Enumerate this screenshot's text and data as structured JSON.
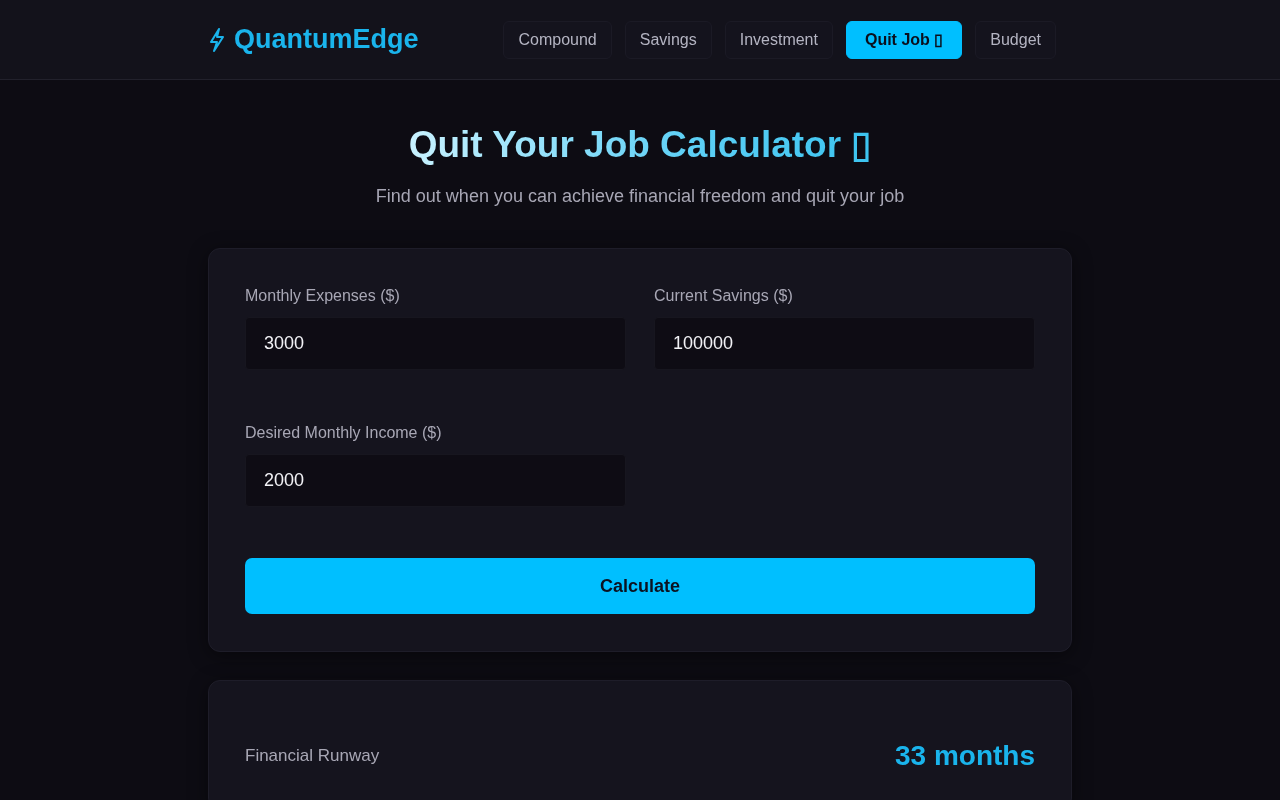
{
  "header": {
    "logo": "QuantumEdge",
    "nav": [
      {
        "label": "Compound",
        "selected": false
      },
      {
        "label": "Savings",
        "selected": false
      },
      {
        "label": "Investment",
        "selected": false
      },
      {
        "label": "Quit Job ▯",
        "selected": true
      },
      {
        "label": "Budget",
        "selected": false
      }
    ]
  },
  "hero": {
    "title": "Quit Your Job Calculator ▯",
    "subtitle": "Find out when you can achieve financial freedom and quit your job"
  },
  "form": {
    "fields": [
      {
        "label": "Monthly Expenses ($)",
        "value": "3000"
      },
      {
        "label": "Current Savings ($)",
        "value": "100000"
      },
      {
        "label": "Desired Monthly Income ($)",
        "value": "2000"
      }
    ],
    "button": "Calculate"
  },
  "results": [
    {
      "label": "Financial Runway",
      "value": "33 months"
    }
  ]
}
